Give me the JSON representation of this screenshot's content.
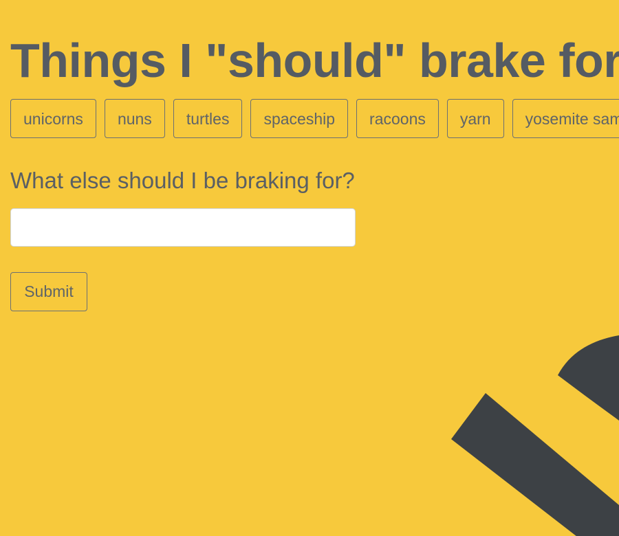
{
  "title": "Things I \"should\" brake for",
  "tags": [
    "unicorns",
    "nuns",
    "turtles",
    "spaceship",
    "racoons",
    "yarn",
    "yosemite sam"
  ],
  "form": {
    "prompt": "What else should I be braking for?",
    "input_value": "",
    "input_placeholder": "",
    "submit_label": "Submit"
  },
  "colors": {
    "background": "#f7c93c",
    "text": "#555b63",
    "graphic": "#3d4145"
  }
}
